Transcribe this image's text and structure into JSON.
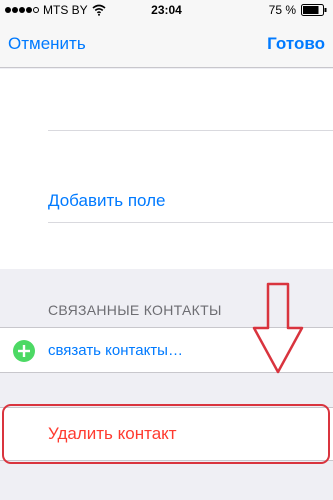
{
  "status_bar": {
    "carrier": "MTS BY",
    "time": "23:04",
    "battery": "75 %"
  },
  "nav": {
    "cancel_label": "Отменить",
    "done_label": "Готово"
  },
  "edit": {
    "add_field_label": "Добавить поле"
  },
  "linked": {
    "section_title": "СВЯЗАННЫЕ КОНТАКТЫ",
    "link_label": "связать контакты…"
  },
  "delete": {
    "label": "Удалить контакт"
  },
  "colors": {
    "accent": "#007aff",
    "destructive": "#ff3b30",
    "add_icon": "#4cd964",
    "annotation": "#d9343e"
  },
  "icons": [
    "wifi-icon",
    "battery-icon",
    "add-icon",
    "arrow-down-annotation"
  ]
}
